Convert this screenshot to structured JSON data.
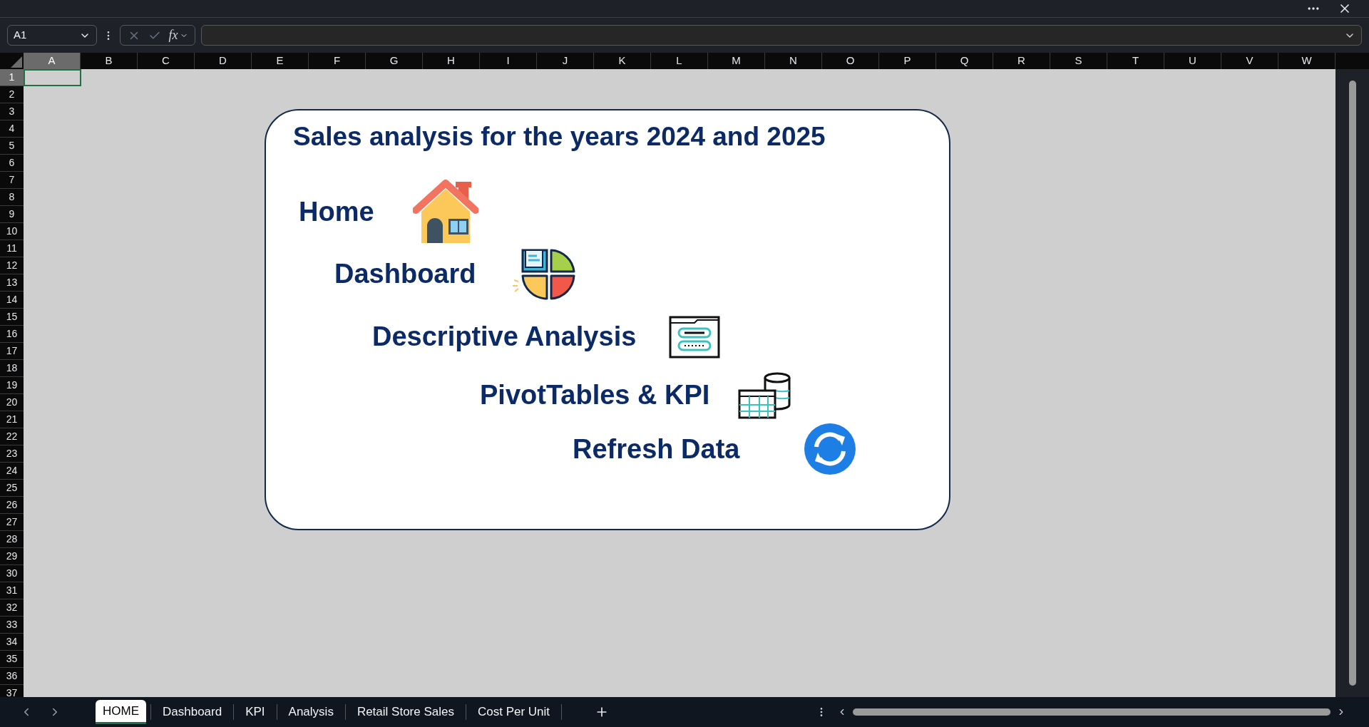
{
  "name_box": "A1",
  "formula_button": "fx",
  "columns": [
    {
      "label": "A",
      "selected": true
    },
    {
      "label": "B",
      "selected": false
    },
    {
      "label": "C",
      "selected": false
    },
    {
      "label": "D",
      "selected": false
    },
    {
      "label": "E",
      "selected": false
    },
    {
      "label": "F",
      "selected": false
    },
    {
      "label": "G",
      "selected": false
    },
    {
      "label": "H",
      "selected": false
    },
    {
      "label": "I",
      "selected": false
    },
    {
      "label": "J",
      "selected": false
    },
    {
      "label": "K",
      "selected": false
    },
    {
      "label": "L",
      "selected": false
    },
    {
      "label": "M",
      "selected": false
    },
    {
      "label": "N",
      "selected": false
    },
    {
      "label": "O",
      "selected": false
    },
    {
      "label": "P",
      "selected": false
    },
    {
      "label": "Q",
      "selected": false
    },
    {
      "label": "R",
      "selected": false
    },
    {
      "label": "S",
      "selected": false
    },
    {
      "label": "T",
      "selected": false
    },
    {
      "label": "U",
      "selected": false
    },
    {
      "label": "V",
      "selected": false
    },
    {
      "label": "W",
      "selected": false
    }
  ],
  "rows": [
    {
      "label": "1",
      "selected": true
    },
    {
      "label": "2",
      "selected": false
    },
    {
      "label": "3",
      "selected": false
    },
    {
      "label": "4",
      "selected": false
    },
    {
      "label": "5",
      "selected": false
    },
    {
      "label": "6",
      "selected": false
    },
    {
      "label": "7",
      "selected": false
    },
    {
      "label": "8",
      "selected": false
    },
    {
      "label": "9",
      "selected": false
    },
    {
      "label": "10",
      "selected": false
    },
    {
      "label": "11",
      "selected": false
    },
    {
      "label": "12",
      "selected": false
    },
    {
      "label": "13",
      "selected": false
    },
    {
      "label": "14",
      "selected": false
    },
    {
      "label": "15",
      "selected": false
    },
    {
      "label": "16",
      "selected": false
    },
    {
      "label": "17",
      "selected": false
    },
    {
      "label": "18",
      "selected": false
    },
    {
      "label": "19",
      "selected": false
    },
    {
      "label": "20",
      "selected": false
    },
    {
      "label": "21",
      "selected": false
    },
    {
      "label": "22",
      "selected": false
    },
    {
      "label": "23",
      "selected": false
    },
    {
      "label": "24",
      "selected": false
    },
    {
      "label": "25",
      "selected": false
    },
    {
      "label": "26",
      "selected": false
    },
    {
      "label": "27",
      "selected": false
    },
    {
      "label": "28",
      "selected": false
    },
    {
      "label": "29",
      "selected": false
    },
    {
      "label": "30",
      "selected": false
    },
    {
      "label": "31",
      "selected": false
    },
    {
      "label": "32",
      "selected": false
    },
    {
      "label": "33",
      "selected": false
    },
    {
      "label": "34",
      "selected": false
    },
    {
      "label": "35",
      "selected": false
    },
    {
      "label": "36",
      "selected": false
    },
    {
      "label": "37",
      "selected": false
    }
  ],
  "card": {
    "title": "Sales analysis for the years 2024 and 2025",
    "links": [
      {
        "label": "Home",
        "kind": "house"
      },
      {
        "label": "Dashboard",
        "kind": "dashboard"
      },
      {
        "label": "Descriptive Analysis",
        "kind": "form"
      },
      {
        "label": "PivotTables & KPI",
        "kind": "pivot"
      },
      {
        "label": "Refresh Data",
        "kind": "refresh"
      }
    ]
  },
  "sheet_tabs": [
    {
      "label": "HOME",
      "selected": true
    },
    {
      "label": "Dashboard",
      "selected": false
    },
    {
      "label": "KPI",
      "selected": false
    },
    {
      "label": "Analysis",
      "selected": false
    },
    {
      "label": "Retail Store Sales",
      "selected": false
    },
    {
      "label": "Cost Per Unit",
      "selected": false
    }
  ]
}
